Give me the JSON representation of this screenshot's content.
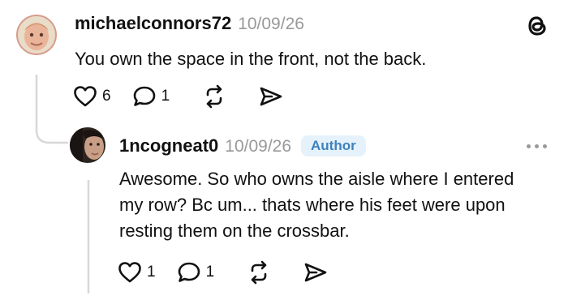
{
  "app": {
    "logo_icon": "threads-logo-icon"
  },
  "thread_line_color": "#d8d8d8",
  "parent_post": {
    "username": "michaelconnors72",
    "date": "10/09/26",
    "text": "You own the space in the front, not the back.",
    "actions": {
      "like_icon": "heart-icon",
      "like_count": "6",
      "reply_icon": "comment-icon",
      "reply_count": "1",
      "repost_icon": "repost-icon",
      "share_icon": "send-icon"
    }
  },
  "reply_post": {
    "username": "1ncogneat0",
    "date": "10/09/26",
    "badge": "Author",
    "badge_colors": {
      "background": "#e6f2fb",
      "text": "#3d82bd"
    },
    "text_lines": [
      "Awesome. So who owns the aisle where I entered",
      "my row? Bc um... thats where his feet were upon",
      "resting them on the crossbar."
    ],
    "more_icon": "more-options-icon",
    "actions": {
      "like_icon": "heart-icon",
      "like_count": "1",
      "reply_icon": "comment-icon",
      "reply_count": "1",
      "repost_icon": "repost-icon",
      "share_icon": "send-icon"
    }
  }
}
